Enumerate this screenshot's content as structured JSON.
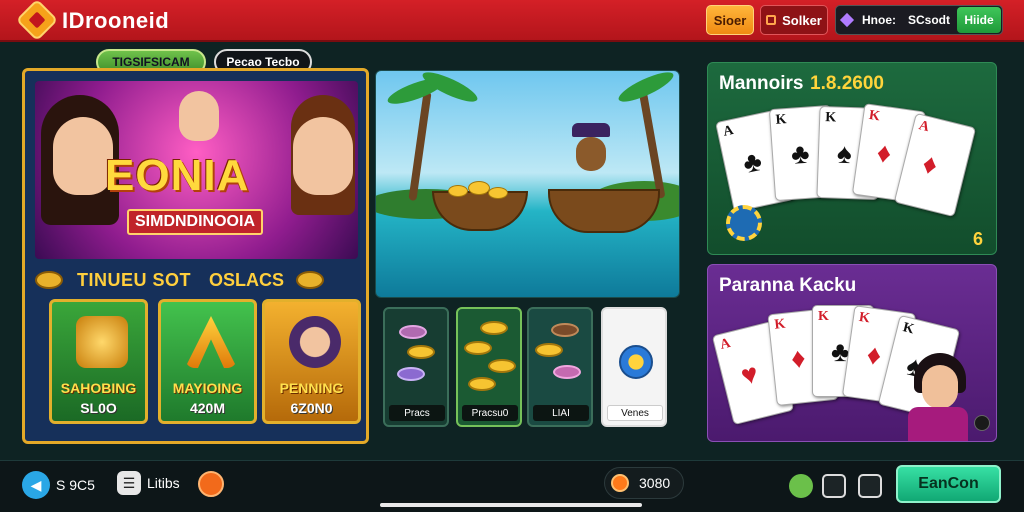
{
  "header": {
    "app_title": "IDrooneid",
    "btn_orange": "Sioer",
    "btn_dark": "Solker",
    "wallet_1": "Hnoe:",
    "wallet_2": "SCsodt",
    "btn_green": "Hiide"
  },
  "pills": {
    "left": "TIGSIFSICAM",
    "right": "Pecao Tecbo"
  },
  "featured": {
    "title": "EONIA",
    "subtitle": "SIMDNDINOOIA",
    "section_left": "TINUEU SOT",
    "section_right": "OSLACS",
    "slots": [
      {
        "name": "SAHOBING",
        "value": "SL0O"
      },
      {
        "name": "MAYIOING",
        "value": "420M"
      },
      {
        "name": "PENNING",
        "value": "6Z0N0"
      }
    ]
  },
  "coin_tiles": [
    {
      "label": "Pracs"
    },
    {
      "label": "Pracsu0"
    },
    {
      "label": "LIAI"
    },
    {
      "label": "Venes"
    }
  ],
  "right_panels": {
    "top_title": "Mannoirs",
    "top_amount": "1.8.2600",
    "top_corner": "6",
    "bottom_title": "Paranna Kacku"
  },
  "bottom": {
    "btn1": "S 9C5",
    "btn2": "Litibs",
    "coins": "3080",
    "cta": "EanCon"
  },
  "colors": {
    "header_red": "#d42027",
    "gold_border": "#e3a928",
    "cta_green": "#11a874",
    "panel_green": "#1d6a3e",
    "panel_purple": "#6a2d93"
  }
}
